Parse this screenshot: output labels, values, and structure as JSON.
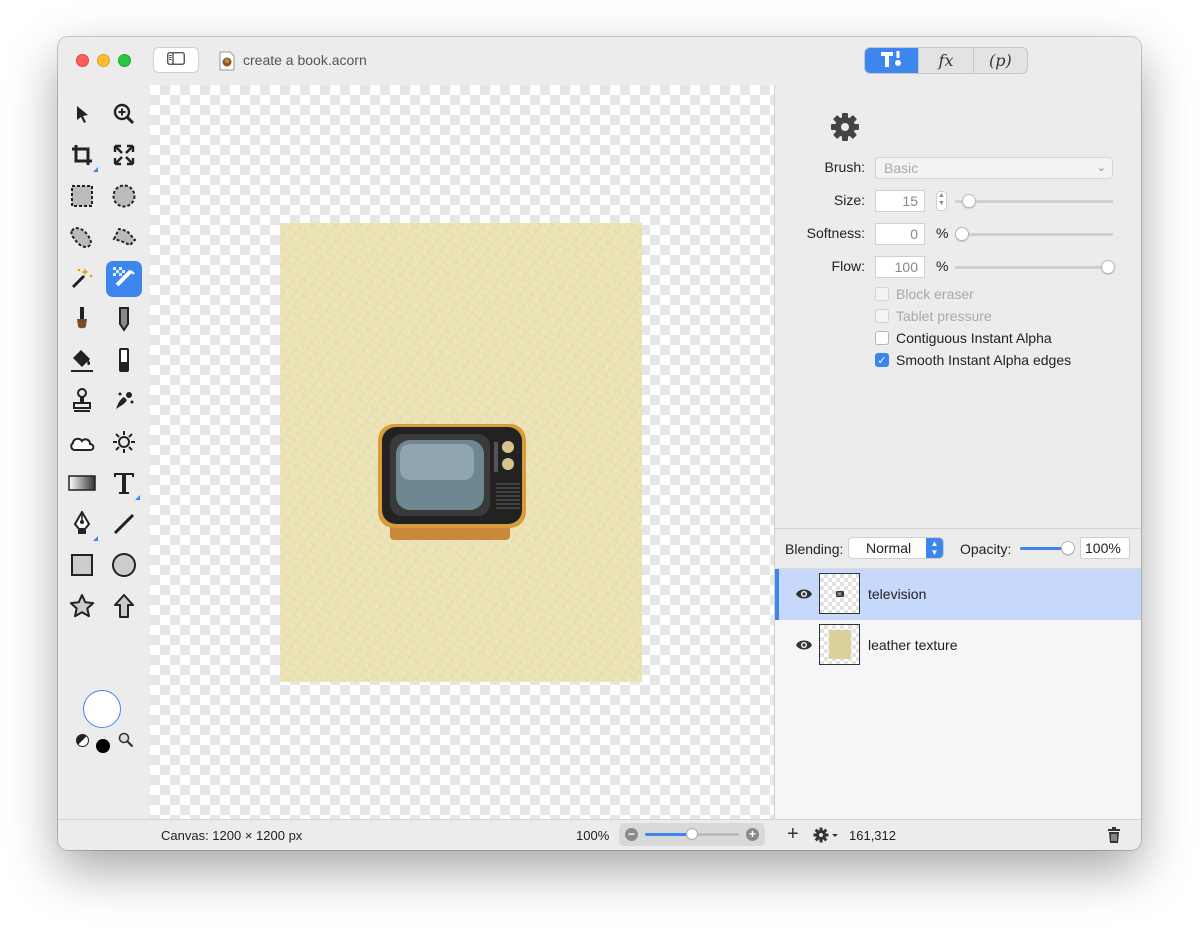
{
  "window": {
    "title": "create a book.acorn"
  },
  "inspector_tabs": [
    {
      "name": "tool-options-tab",
      "label": "",
      "active": true
    },
    {
      "name": "fx-tab",
      "label": "fx",
      "active": false
    },
    {
      "name": "p-tab",
      "label": "(p)",
      "active": false
    }
  ],
  "tools": [
    {
      "name": "move-arrow-tool-icon"
    },
    {
      "name": "zoom-tool-icon"
    },
    {
      "name": "crop-tool-icon"
    },
    {
      "name": "transform-tool-icon"
    },
    {
      "name": "rect-select-tool-icon"
    },
    {
      "name": "ellipse-select-tool-icon"
    },
    {
      "name": "lasso-tool-icon"
    },
    {
      "name": "polygon-lasso-tool-icon"
    },
    {
      "name": "magic-wand-tool-icon"
    },
    {
      "name": "instant-alpha-tool-icon",
      "active": true
    },
    {
      "name": "brush-tool-icon"
    },
    {
      "name": "pencil-tool-icon"
    },
    {
      "name": "paint-bucket-tool-icon"
    },
    {
      "name": "eraser-tool-icon"
    },
    {
      "name": "clone-stamp-tool-icon"
    },
    {
      "name": "smudge-tool-icon"
    },
    {
      "name": "cloud-tool-icon"
    },
    {
      "name": "sun-tool-icon"
    },
    {
      "name": "gradient-tool-icon"
    },
    {
      "name": "text-tool-icon"
    },
    {
      "name": "pen-tool-icon"
    },
    {
      "name": "line-tool-icon"
    },
    {
      "name": "rectangle-shape-tool-icon"
    },
    {
      "name": "oval-shape-tool-icon"
    },
    {
      "name": "star-tool-icon"
    },
    {
      "name": "arrow-shape-tool-icon"
    }
  ],
  "brush_options": {
    "brush_label": "Brush:",
    "brush_value": "Basic",
    "size_label": "Size:",
    "size_value": "15",
    "softness_label": "Softness:",
    "softness_value": "0",
    "softness_unit": "%",
    "flow_label": "Flow:",
    "flow_value": "100",
    "flow_unit": "%",
    "checkboxes": [
      {
        "label": "Block eraser",
        "checked": false,
        "enabled": false
      },
      {
        "label": "Tablet pressure",
        "checked": false,
        "enabled": false
      },
      {
        "label": "Contiguous Instant Alpha",
        "checked": false,
        "enabled": true
      },
      {
        "label": "Smooth Instant Alpha edges",
        "checked": true,
        "enabled": true
      }
    ]
  },
  "layers_panel": {
    "blending_label": "Blending:",
    "blending_value": "Normal",
    "opacity_label": "Opacity:",
    "opacity_value": "100%",
    "layers": [
      {
        "name": "television",
        "selected": true,
        "visible": true
      },
      {
        "name": "leather texture",
        "selected": false,
        "visible": true
      }
    ],
    "count": "161,312"
  },
  "status_bar": {
    "canvas_size": "Canvas: 1200 × 1200 px",
    "zoom": "100%"
  },
  "colors": {
    "accent": "#3d86f0",
    "leather": "#ece4b6",
    "close": "#fe5f57",
    "minimize": "#febc2e",
    "zoom": "#28c840"
  }
}
